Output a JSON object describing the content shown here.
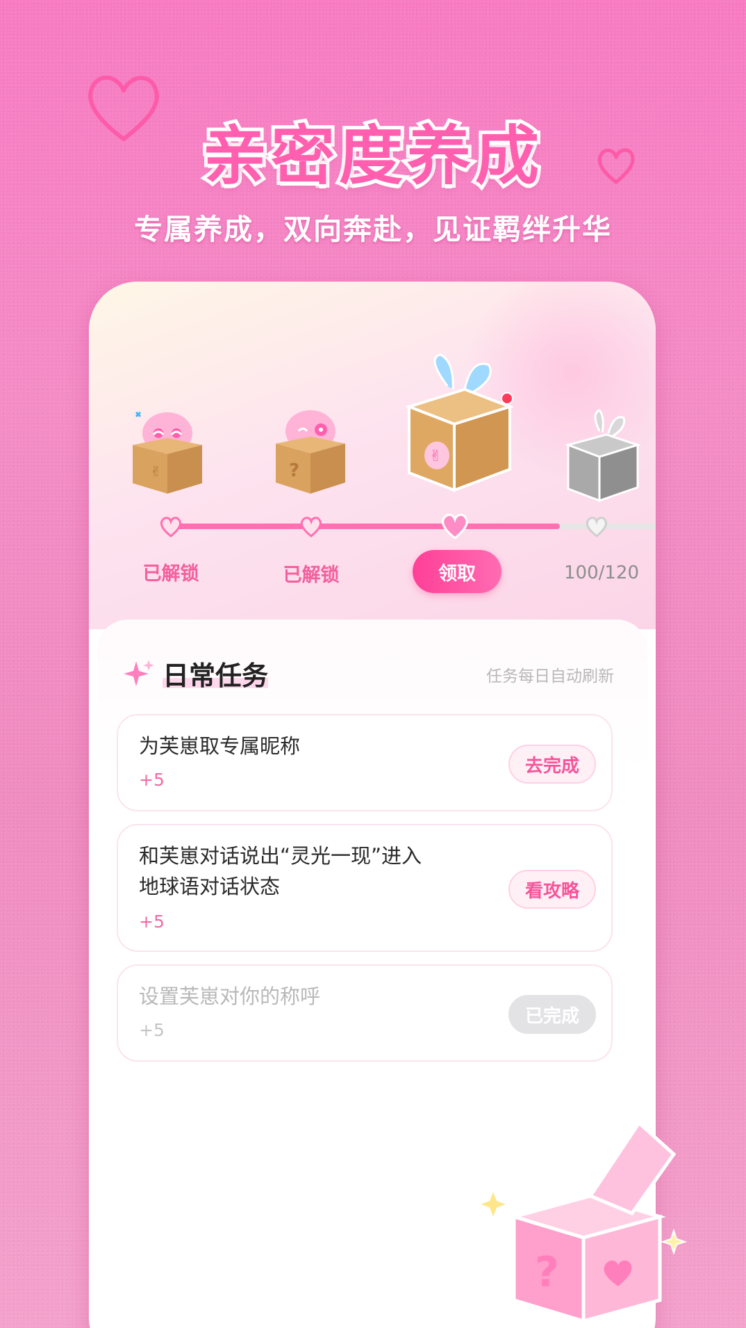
{
  "header": {
    "title": "亲密度养成",
    "subtitle": "专属养成，双向奔赴，见证羁绊升华"
  },
  "progress": {
    "stages": [
      {
        "label": "已解锁",
        "state": "unlocked"
      },
      {
        "label": "已解锁",
        "state": "unlocked"
      },
      {
        "label": "领取",
        "state": "claimable"
      },
      {
        "label": "100/120",
        "state": "locked"
      }
    ],
    "current": 100,
    "target": 120
  },
  "daily_tasks": {
    "title": "日常任务",
    "note": "任务每日自动刷新",
    "items": [
      {
        "text": "为芙崽取专属昵称",
        "points": "+5",
        "action": "去完成",
        "done": false
      },
      {
        "text_line1": "和芙崽对话说出“灵光一现”进入",
        "text_line2": "地球语对话状态",
        "points": "+5",
        "action": "看攻略",
        "done": false
      },
      {
        "text": "设置芙崽对你的称呼",
        "points": "+5",
        "action": "已完成",
        "done": true
      }
    ]
  },
  "colors": {
    "accent": "#ff4fa0",
    "background": "#f48cc6",
    "track_fill": "#ff6fb1",
    "done_gray": "#e3e3e6"
  },
  "icons": [
    "heart-doodle-icon",
    "sparkle-icon",
    "heart-node-icon",
    "gift-box-icon"
  ]
}
